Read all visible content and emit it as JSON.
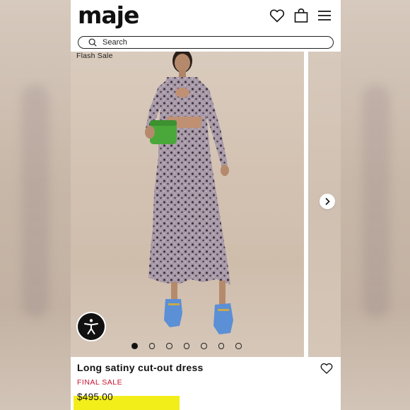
{
  "brand": {
    "logo_text": "maje"
  },
  "header": {
    "icons": [
      "heart-icon",
      "shopping-bag-icon",
      "hamburger-menu-icon"
    ]
  },
  "search": {
    "placeholder": "Search",
    "icon": "search-icon"
  },
  "carousel": {
    "badge": "Flash Sale",
    "image_count": 7,
    "active_index": 0,
    "next_icon": "chevron-right-icon"
  },
  "accessibility": {
    "icon": "accessibility-icon"
  },
  "product": {
    "title": "Long satiny cut-out dress",
    "status": "FINAL SALE",
    "price": "$495.00",
    "wishlist_icon": "heart-outline-icon"
  },
  "colors": {
    "sale_red": "#c8102e",
    "highlight_yellow": "#f2ee1a",
    "text": "#111111",
    "shoe_blue": "#5b8fd6",
    "bag_green": "#4aa83a"
  }
}
